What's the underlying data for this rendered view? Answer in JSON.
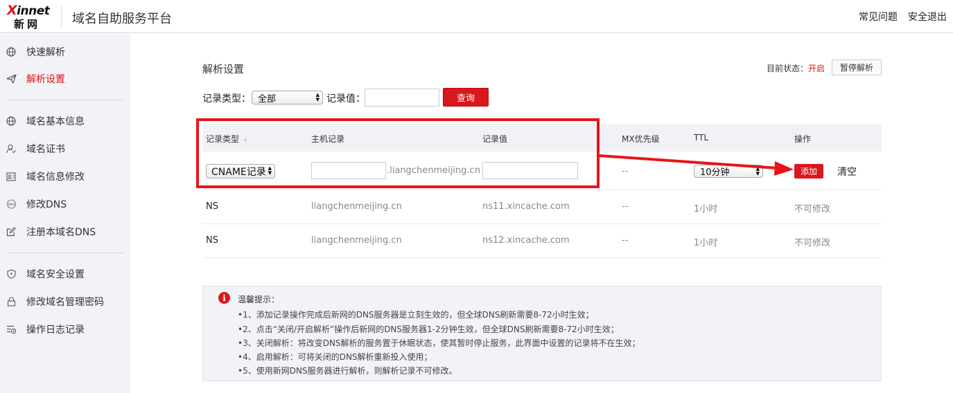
{
  "header": {
    "logo_top": "innet",
    "logo_x": "X",
    "logo_bottom": "新网",
    "platform_title": "域名自助服务平台",
    "faq_label": "常见问题",
    "logout_label": "安全退出"
  },
  "sidebar": {
    "items": [
      {
        "label": "快速解析",
        "icon": "globe-icon"
      },
      {
        "label": "解析设置",
        "icon": "send-icon",
        "active": true
      },
      {
        "label": "域名基本信息",
        "icon": "globe-icon"
      },
      {
        "label": "域名证书",
        "icon": "user-cert-icon"
      },
      {
        "label": "域名信息修改",
        "icon": "id-card-icon"
      },
      {
        "label": "修改DNS",
        "icon": "dns-icon"
      },
      {
        "label": "注册本域名DNS",
        "icon": "edit-icon"
      },
      {
        "label": "域名安全设置",
        "icon": "shield-icon"
      },
      {
        "label": "修改域名管理密码",
        "icon": "lock-icon"
      },
      {
        "label": "操作日志记录",
        "icon": "log-icon"
      }
    ]
  },
  "main": {
    "section_title": "解析设置",
    "status_label": "目前状态：",
    "status_value": "开启",
    "pause_button": "暂停解析",
    "filter": {
      "record_type_label": "记录类型：",
      "record_type_value": "全部",
      "record_value_label": "记录值：",
      "record_value_input": "",
      "query_button": "查询"
    }
  },
  "table": {
    "headers": [
      "记录类型",
      "主机记录",
      "记录值",
      "MX优先级",
      "TTL",
      "操作"
    ],
    "sort_marker": "‹",
    "new_row": {
      "type_value": "CNAME记录",
      "host_input": "",
      "domain_suffix": ".liangchenmeijing.cn",
      "value_input": "",
      "mx": "--",
      "ttl_value": "10分钟",
      "add_button": "添加",
      "clear_link": "清空"
    },
    "rows": [
      {
        "type": "NS",
        "host": "liangchenmeijing.cn",
        "value": "ns11.xincache.com",
        "mx": "--",
        "ttl": "1小时",
        "action": "不可修改"
      },
      {
        "type": "NS",
        "host": "liangchenmeijing.cn",
        "value": "ns12.xincache.com",
        "mx": "--",
        "ttl": "1小时",
        "action": "不可修改"
      }
    ]
  },
  "tips": {
    "icon_glyph": "i",
    "title": "温馨提示：",
    "lines": [
      "•1、添加记录操作完成后新网的DNS服务器是立刻生效的，但全球DNS刷新需要8-72小时生效；",
      "•2、点击“关闭/开启解析”操作后新网的DNS服务器1-2分钟生效，但全球DNS刷新需要8-72小时生效；",
      "•3、关闭解析：将改变DNS解析的服务置于休眠状态，使其暂时停止服务，此界面中设置的记录将不在生效；",
      "•4、启用解析：可将关闭的DNS解析重新投入使用；",
      "•5、使用新网DNS服务器进行解析，则解析记录不可修改。"
    ]
  },
  "colors": {
    "brand_red": "#e1141c",
    "sidebar_bg": "#f2f3f7",
    "table_header_bg": "#f1f2f6"
  }
}
